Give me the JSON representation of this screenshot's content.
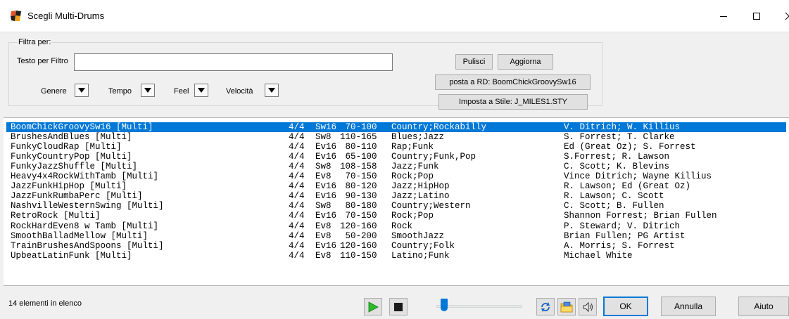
{
  "window": {
    "title": "Scegli Multi-Drums"
  },
  "filter": {
    "group_label": "Filtra per:",
    "text_label": "Testo per Filtro",
    "text_value": "",
    "genre_label": "Genere",
    "tempo_label": "Tempo",
    "feel_label": "Feel",
    "velocity_label": "Velocità"
  },
  "buttons": {
    "clear": "Pulisci",
    "refresh": "Aggiorna",
    "set_rd": "posta a RD: BoomChickGroovySw16",
    "set_style": "Imposta a Stile: J_MILES1.STY"
  },
  "list": {
    "selected_index": 0,
    "rows": [
      {
        "name": "BoomChickGroovySw16 [Multi]",
        "sig": "4/4",
        "feel": "Sw16",
        "tempo": " 70-100",
        "genre": "Country;Rockabilly",
        "artist": "V. Ditrich; W. Killius"
      },
      {
        "name": "BrushesAndBlues [Multi]",
        "sig": "4/4",
        "feel": "Sw8",
        "tempo": "110-165",
        "genre": "Blues;Jazz",
        "artist": "S. Forrest; T. Clarke"
      },
      {
        "name": "FunkyCloudRap [Multi]",
        "sig": "4/4",
        "feel": "Ev16",
        "tempo": " 80-110",
        "genre": "Rap;Funk",
        "artist": "Ed (Great Oz); S. Forrest"
      },
      {
        "name": "FunkyCountryPop [Multi]",
        "sig": "4/4",
        "feel": "Ev16",
        "tempo": " 65-100",
        "genre": "Country;Funk,Pop",
        "artist": "S.Forrest; R. Lawson"
      },
      {
        "name": "FunkyJazzShuffle [Multi]",
        "sig": "4/4",
        "feel": "Sw8",
        "tempo": "108-158",
        "genre": "Jazz;Funk",
        "artist": "C. Scott; K. Blevins"
      },
      {
        "name": "Heavy4x4RockWithTamb [Multi]",
        "sig": "4/4",
        "feel": "Ev8",
        "tempo": " 70-150",
        "genre": "Rock;Pop",
        "artist": "Vince Ditrich; Wayne Killius"
      },
      {
        "name": "JazzFunkHipHop [Multi]",
        "sig": "4/4",
        "feel": "Ev16",
        "tempo": " 80-120",
        "genre": "Jazz;HipHop",
        "artist": "R. Lawson; Ed (Great Oz)"
      },
      {
        "name": "JazzFunkRumbaPerc [Multi]",
        "sig": "4/4",
        "feel": "Ev16",
        "tempo": " 90-130",
        "genre": "Jazz;Latino",
        "artist": "R. Lawson; C. Scott"
      },
      {
        "name": "NashvilleWesternSwing [Multi]",
        "sig": "4/4",
        "feel": "Sw8",
        "tempo": " 80-180",
        "genre": "Country;Western",
        "artist": "C. Scott; B. Fullen"
      },
      {
        "name": "RetroRock [Multi]",
        "sig": "4/4",
        "feel": "Ev16",
        "tempo": " 70-150",
        "genre": "Rock;Pop",
        "artist": "Shannon Forrest; Brian Fullen"
      },
      {
        "name": "RockHardEven8 w Tamb [Multi]",
        "sig": "4/4",
        "feel": "Ev8",
        "tempo": "120-160",
        "genre": "Rock",
        "artist": "P. Steward; V. Ditrich"
      },
      {
        "name": "SmoothBalladMellow [Multi]",
        "sig": "4/4",
        "feel": "Ev8",
        "tempo": " 50-200",
        "genre": "SmoothJazz",
        "artist": "Brian Fullen; PG Artist"
      },
      {
        "name": "TrainBrushesAndSpoons [Multi]",
        "sig": "4/4",
        "feel": "Ev16",
        "tempo": "120-160",
        "genre": "Country;Folk",
        "artist": "A. Morris; S. Forrest"
      },
      {
        "name": "UpbeatLatinFunk [Multi]",
        "sig": "4/4",
        "feel": "Ev8",
        "tempo": "110-150",
        "genre": "Latino;Funk",
        "artist": "Michael White"
      }
    ]
  },
  "status": {
    "count_text": "14 elementi in elenco"
  },
  "player": {
    "volume_level": 0.05
  },
  "dialog": {
    "ok": "OK",
    "cancel": "Annulla",
    "help": "Aiuto"
  },
  "colors": {
    "selection": "#0078d7",
    "play_green": "#2dbb2d",
    "accent_blue": "#0078d7"
  },
  "icons": [
    "app-icon",
    "minimize-icon",
    "maximize-icon",
    "close-icon",
    "dropdown-arrow-icon",
    "play-icon",
    "stop-icon",
    "loop-icon",
    "folder-icon",
    "speaker-icon"
  ]
}
